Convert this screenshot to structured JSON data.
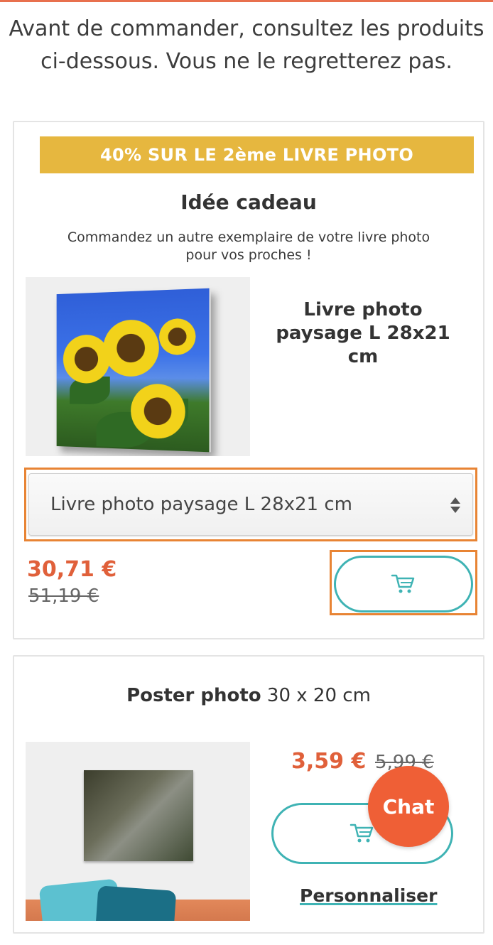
{
  "intro": {
    "line1": "Avant de commander, consultez les produits",
    "line2": "ci-dessous. Vous ne le regretterez pas."
  },
  "offer1": {
    "banner": "40% SUR LE 2ème LIVRE PHOTO",
    "title": "Idée cadeau",
    "desc_line1": "Commandez un autre exemplaire de votre livre photo",
    "desc_line2": "pour vos proches !",
    "product_name_line1": "Livre photo",
    "product_name_line2": "paysage L 28x21",
    "product_name_line3": "cm",
    "select_value": "Livre photo paysage L 28x21 cm",
    "price_current": "30,71 €",
    "price_old": "51,19 €",
    "cart_icon": "cart-icon"
  },
  "offer2": {
    "title_bold": "Poster photo",
    "title_rest": " 30 x 20 cm",
    "price_current": "3,59 €",
    "price_old": "5,99 €",
    "customize_label": "Personnaliser",
    "cart_icon": "cart-icon"
  },
  "chat": {
    "label": "Chat"
  },
  "colors": {
    "accent_orange": "#e0603a",
    "banner_yellow": "#e6b73f",
    "teal": "#3fb3b4",
    "highlight_orange": "#e88434"
  }
}
